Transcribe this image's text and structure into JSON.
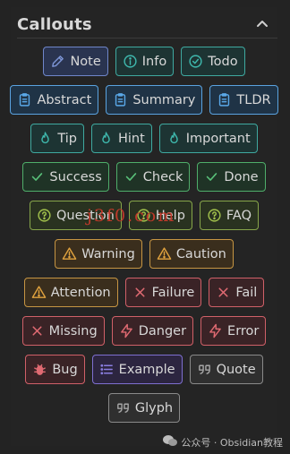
{
  "panel": {
    "title": "Callouts"
  },
  "callouts": [
    [
      {
        "label": "Note",
        "icon": "pencil-icon",
        "style": "note"
      },
      {
        "label": "Info",
        "icon": "info-icon",
        "style": "teal"
      },
      {
        "label": "Todo",
        "icon": "check-circle-icon",
        "style": "teal"
      }
    ],
    [
      {
        "label": "Abstract",
        "icon": "clipboard-icon",
        "style": "lblue"
      },
      {
        "label": "Summary",
        "icon": "clipboard-icon",
        "style": "lblue"
      },
      {
        "label": "TLDR",
        "icon": "clipboard-icon",
        "style": "lblue"
      }
    ],
    [
      {
        "label": "Tip",
        "icon": "flame-icon",
        "style": "teal"
      },
      {
        "label": "Hint",
        "icon": "flame-icon",
        "style": "teal"
      },
      {
        "label": "Important",
        "icon": "flame-icon",
        "style": "teal"
      }
    ],
    [
      {
        "label": "Success",
        "icon": "check-icon",
        "style": "green"
      },
      {
        "label": "Check",
        "icon": "check-icon",
        "style": "green"
      },
      {
        "label": "Done",
        "icon": "check-icon",
        "style": "green"
      }
    ],
    [
      {
        "label": "Question",
        "icon": "help-circle-icon",
        "style": "olive"
      },
      {
        "label": "Help",
        "icon": "help-circle-icon",
        "style": "olive"
      },
      {
        "label": "FAQ",
        "icon": "help-circle-icon",
        "style": "olive"
      }
    ],
    [
      {
        "label": "Warning",
        "icon": "warning-icon",
        "style": "orange"
      },
      {
        "label": "Caution",
        "icon": "warning-icon",
        "style": "orange"
      }
    ],
    [
      {
        "label": "Attention",
        "icon": "warning-icon",
        "style": "orange"
      },
      {
        "label": "Failure",
        "icon": "x-icon",
        "style": "red"
      },
      {
        "label": "Fail",
        "icon": "x-icon",
        "style": "red"
      }
    ],
    [
      {
        "label": "Missing",
        "icon": "x-icon",
        "style": "red"
      },
      {
        "label": "Danger",
        "icon": "zap-icon",
        "style": "red"
      },
      {
        "label": "Error",
        "icon": "zap-icon",
        "style": "red"
      }
    ],
    [
      {
        "label": "Bug",
        "icon": "bug-icon",
        "style": "red"
      },
      {
        "label": "Example",
        "icon": "list-icon",
        "style": "purple"
      },
      {
        "label": "Quote",
        "icon": "quote-icon",
        "style": "gray"
      }
    ],
    [
      {
        "label": "Glyph",
        "icon": "quote-icon",
        "style": "gray"
      }
    ]
  ],
  "icon_colors": {
    "pencil-icon": "#7d95d6",
    "info-icon": "#3fb9ae",
    "check-circle-icon": "#3fb9ae",
    "clipboard-icon": "#5aa8e8",
    "flame-icon": "#3fb9ae",
    "check-icon": "#59c27a",
    "help-circle-icon": "#a2c24c",
    "warning-icon": "#e0a23e",
    "x-icon": "#e06a72",
    "zap-icon": "#e06a72",
    "bug-icon": "#e06a72",
    "list-icon": "#8a7ee0",
    "quote-icon": "#a6a6a6"
  },
  "watermark": {
    "text": "公众号 · Obsidian教程"
  },
  "overlay_text": "j3f0.com"
}
